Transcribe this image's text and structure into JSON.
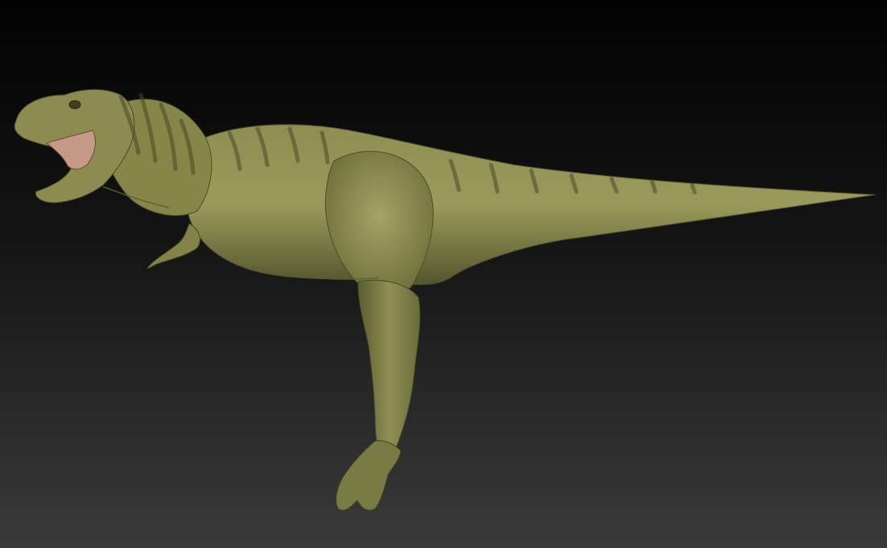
{
  "scene": {
    "subject_icon": "dinosaur-model-icon",
    "colors": {
      "background_top": "#020202",
      "background_bottom": "#3a3a3a",
      "skin_light": "#9a9a5c",
      "skin_mid": "#7f7f47",
      "skin_dark": "#55552c",
      "stripe": "#4a4a2a",
      "mouth_interior": "#c49a86"
    }
  }
}
